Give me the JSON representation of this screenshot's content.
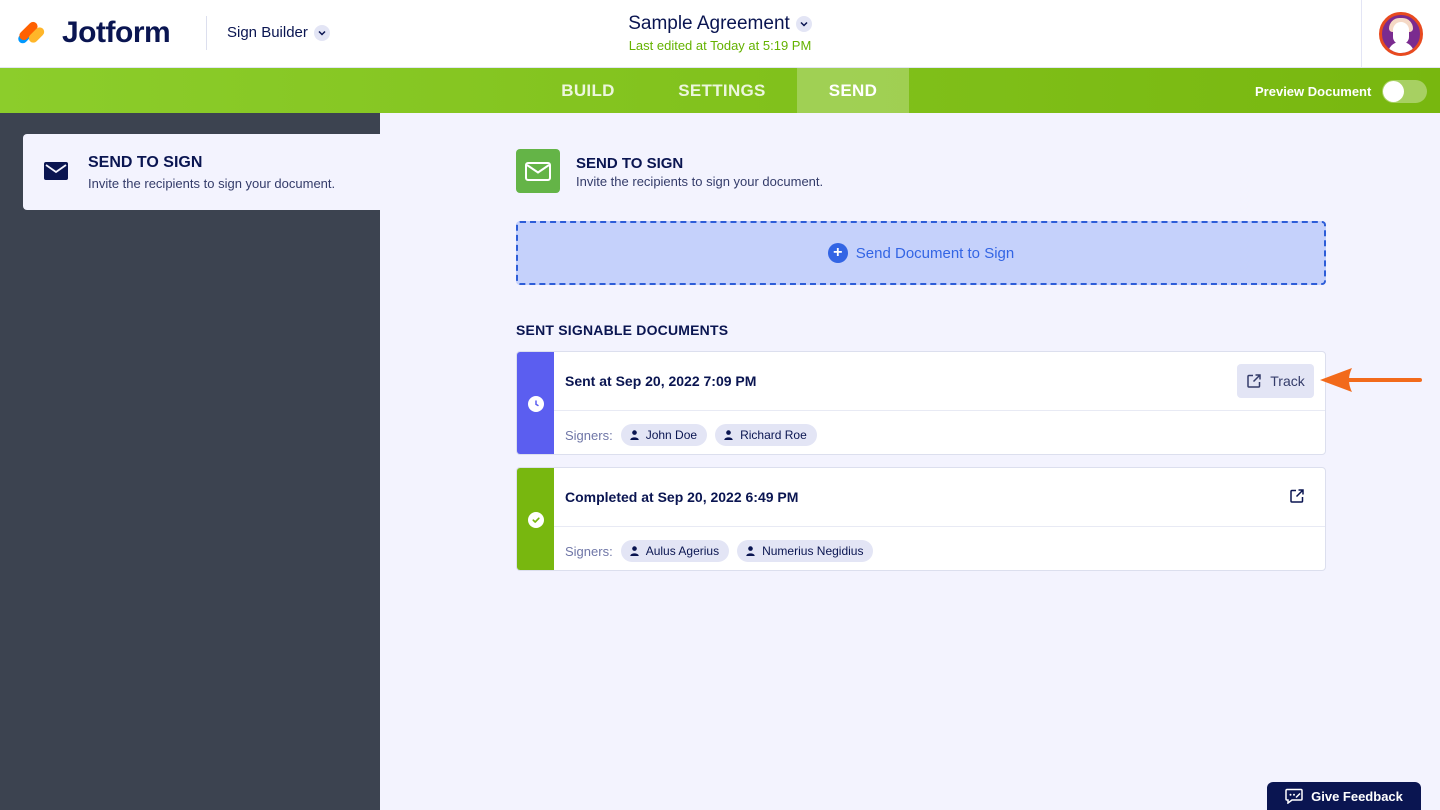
{
  "header": {
    "logo_text": "Jotform",
    "product_name": "Sign Builder",
    "document_title": "Sample Agreement",
    "last_edited": "Last edited at Today at 5:19 PM"
  },
  "nav": {
    "tabs": [
      {
        "label": "BUILD",
        "active": false
      },
      {
        "label": "SETTINGS",
        "active": false
      },
      {
        "label": "SEND",
        "active": true
      }
    ],
    "preview_label": "Preview Document",
    "preview_enabled": false
  },
  "sidebar": {
    "items": [
      {
        "title": "SEND TO SIGN",
        "subtitle": "Invite the recipients to sign your document.",
        "icon": "envelope-icon"
      }
    ]
  },
  "main": {
    "section_title": "SEND TO SIGN",
    "section_subtitle": "Invite the recipients to sign your document.",
    "send_button_label": "Send Document to Sign",
    "list_title": "SENT SIGNABLE DOCUMENTS",
    "documents": [
      {
        "status": "pending",
        "status_icon": "clock-icon",
        "heading": "Sent at Sep 20, 2022 7:09 PM",
        "signers_label": "Signers:",
        "signers": [
          "John Doe",
          "Richard Roe"
        ],
        "action_label": "Track"
      },
      {
        "status": "completed",
        "status_icon": "check-icon",
        "heading": "Completed at Sep 20, 2022 6:49 PM",
        "signers_label": "Signers:",
        "signers": [
          "Aulus Agerius",
          "Numerius Negidius"
        ]
      }
    ]
  },
  "feedback_label": "Give Feedback",
  "colors": {
    "brand_green": "#78b70f",
    "pending_purple": "#5b5ef0",
    "accent_blue": "#3365e4",
    "annotation_orange": "#f26a1b",
    "navy": "#0a1551"
  }
}
